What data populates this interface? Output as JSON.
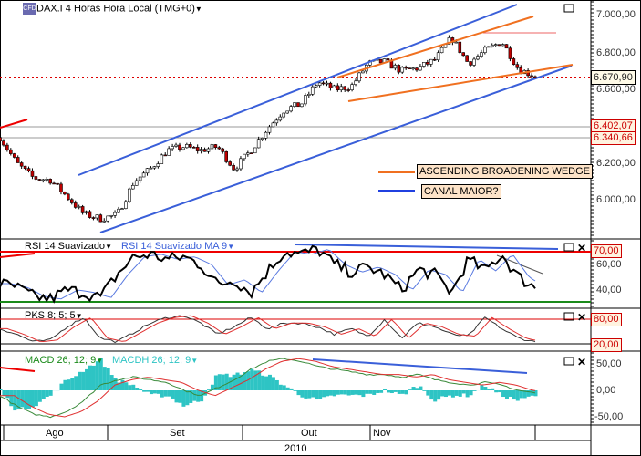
{
  "header": {
    "title": "DAX.I 4 Horas Hora Local (TMG+0)",
    "logo": "CFD"
  },
  "price_panel": {
    "axis_labels": [
      "7.000,00",
      "6.800,00",
      "6.600,00",
      "6.200,00",
      "6.000,00"
    ],
    "last_price": "6.670,90",
    "level_1": "6.402,07",
    "level_2": "6.340,66",
    "annotations": {
      "orange": "ASCENDING BROADENING WEDGE",
      "blue": "CANAL MAIOR?"
    }
  },
  "rsi_panel": {
    "title": "RSI 14 Suavizado",
    "ma_title": "RSI 14 Suavizado MA 9",
    "axis_labels": [
      "70,00",
      "60,00",
      "40,00"
    ]
  },
  "pks_panel": {
    "title": "PKS 8; 5; 5",
    "axis_labels": [
      "80,00",
      "20,00"
    ]
  },
  "macd_panel": {
    "title": "MACD 26; 12; 9",
    "hist_title": "MACDH 26; 12; 9",
    "axis_labels": [
      "50,00",
      "0,00",
      "-50,00"
    ]
  },
  "time_axis": {
    "months": [
      "Ago",
      "Set",
      "Out",
      "Nov"
    ],
    "year": "2010"
  },
  "colors": {
    "up": "#ffffff",
    "down": "#c00000",
    "blue": "#3a5fd9",
    "orange": "#f07020",
    "red": "#e00000",
    "cyan": "#2ec4c4",
    "green": "#1a8a1a"
  },
  "chart_data": {
    "type": "candlestick",
    "title": "DAX.I 4 Horas",
    "ylim": [
      5840,
      7080
    ],
    "x_range": [
      "Jul 2010",
      "Nov 2010"
    ],
    "close": [
      6340,
      6200,
      6120,
      6110,
      6020,
      5925,
      5900,
      5920,
      6100,
      6170,
      6270,
      6290,
      6270,
      6290,
      6170,
      6270,
      6390,
      6490,
      6520,
      6640,
      6600,
      6615,
      6740,
      6750,
      6700,
      6715,
      6760,
      6880,
      6740,
      6810,
      6860,
      6710,
      6670.9
    ],
    "rsi": [
      45,
      42,
      35,
      33,
      40,
      38,
      34,
      52,
      66,
      68,
      64,
      66,
      60,
      44,
      48,
      38,
      55,
      70,
      68,
      72,
      60,
      54,
      58,
      52,
      40,
      56,
      52,
      38,
      64,
      55,
      68,
      50,
      42
    ],
    "pks": [
      55,
      40,
      20,
      25,
      60,
      85,
      30,
      20,
      45,
      70,
      85,
      90,
      70,
      40,
      60,
      85,
      55,
      70,
      70,
      60,
      40,
      55,
      35,
      80,
      30,
      70,
      60,
      40,
      35,
      85,
      55,
      30,
      20
    ],
    "macd": [
      -10,
      -30,
      -45,
      -50,
      -40,
      -20,
      10,
      20,
      25,
      20,
      15,
      0,
      -10,
      5,
      20,
      40,
      55,
      60,
      55,
      45,
      40,
      35,
      30,
      30,
      25,
      30,
      20,
      15,
      10,
      15,
      10,
      0,
      -5
    ]
  }
}
